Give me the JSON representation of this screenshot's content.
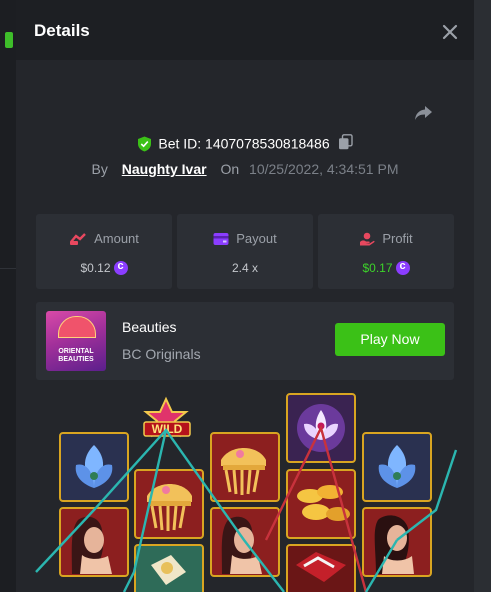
{
  "modal": {
    "title": "Details"
  },
  "bet": {
    "id_label": "Bet ID: 1407078530818486",
    "by_label": "By",
    "user": "Naughty Ivar",
    "on_label": "On",
    "date": "10/25/2022, 4:34:51 PM"
  },
  "stats": {
    "amount": {
      "label": "Amount",
      "value": "$0.12"
    },
    "payout": {
      "label": "Payout",
      "value": "2.4 x"
    },
    "profit": {
      "label": "Profit",
      "value": "$0.17"
    }
  },
  "game": {
    "name": "Beauties",
    "provider": "BC Originals",
    "thumb_text": "ORIENTAL BEAUTIES",
    "play_label": "Play Now"
  },
  "reels": {
    "wild_label": "WILD"
  },
  "colors": {
    "accent_green": "#3bc117",
    "profit_green": "#3dd32a",
    "coin_purple": "#8b3dff",
    "tile_border_gold": "#d9a521"
  }
}
